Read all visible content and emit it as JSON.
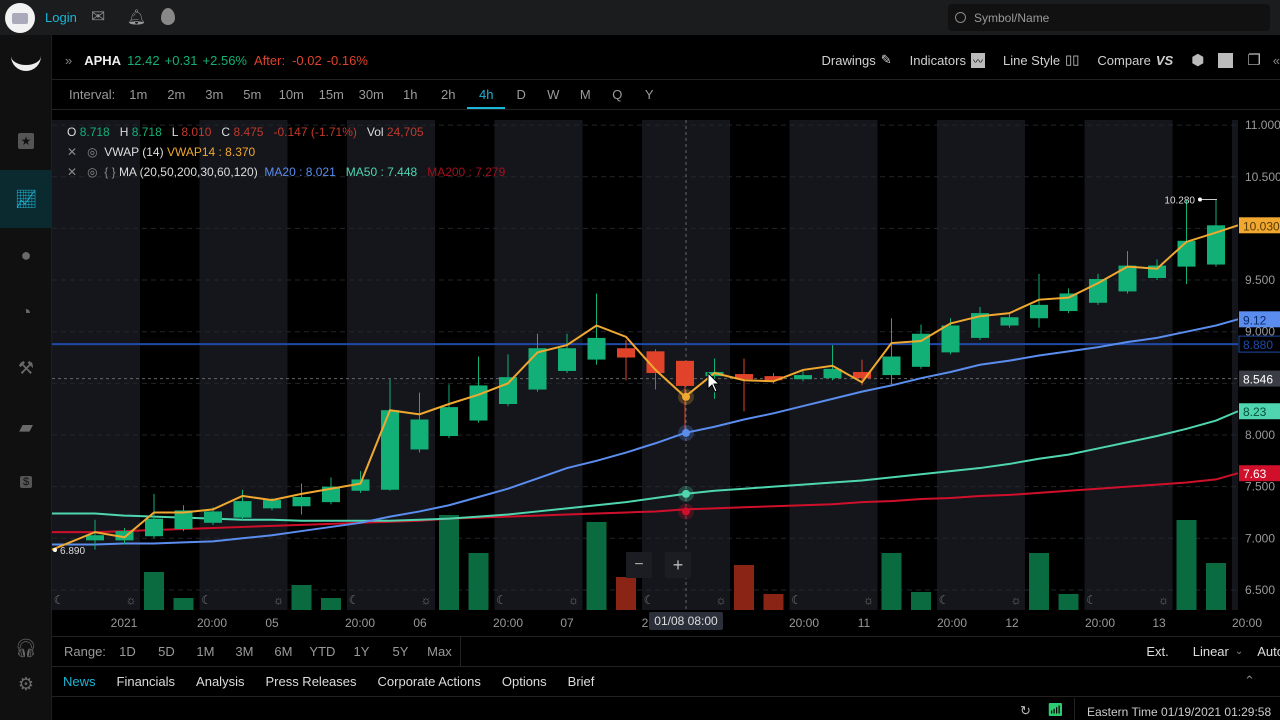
{
  "topbar": {
    "login": "Login",
    "search_placeholder": "Symbol/Name",
    "icons": [
      "avatar",
      "mail-icon",
      "bell-icon",
      "flame-icon"
    ]
  },
  "sidebar": {
    "items": [
      "star-icon",
      "chart-icon",
      "planet-icon",
      "chat-chart-icon",
      "gavel-icon",
      "wallet-icon",
      "dollar-icon"
    ],
    "bottom": [
      "headset-icon",
      "gear-icon"
    ],
    "active": "chart-icon"
  },
  "quote": {
    "symbol": "APHA",
    "price": "12.42",
    "change": "+0.31",
    "change_pct": "+2.56%",
    "after_label": "After:",
    "after_change": "-0.02",
    "after_pct": "-0.16%"
  },
  "toolbar": {
    "drawings": "Drawings",
    "indicators": "Indicators",
    "line_style": "Line Style",
    "compare": "Compare",
    "compare_badge": "VS"
  },
  "interval": {
    "label": "Interval:",
    "options": [
      "1m",
      "2m",
      "3m",
      "5m",
      "10m",
      "15m",
      "30m",
      "1h",
      "2h",
      "4h",
      "D",
      "W",
      "M",
      "Q",
      "Y"
    ],
    "selected": "4h"
  },
  "legend": {
    "ohlc": {
      "o_label": "O",
      "o": "8.718",
      "h_label": "H",
      "h": "8.718",
      "l_label": "L",
      "l": "8.010",
      "c_label": "C",
      "c": "8.475",
      "chg": "-0.147 (-1.71%)",
      "vol_label": "Vol",
      "vol": "24,705"
    },
    "vwap": {
      "name": "VWAP (14)",
      "value": "VWAP14 : 8.370"
    },
    "ma": {
      "braces": "{ }",
      "name": "MA (20,50,200,30,60,120)",
      "ma20": "MA20 : 8.021",
      "ma50": "MA50 : 7.448",
      "ma200": "MA200 : 7.279"
    }
  },
  "colors": {
    "up": "#12b076",
    "down": "#e0432a",
    "vwap": "#f0a830",
    "ma20": "#5b8def",
    "ma50": "#4fd6b0",
    "ma200": "#d0102a",
    "hline": "#1f4aa8",
    "accent": "#1bb5d6"
  },
  "chart_data": {
    "type": "candlestick",
    "ylim": [
      6.4,
      11.05
    ],
    "y_ticks": [
      "11.000",
      "10.500",
      "9.500",
      "9.000",
      "8.000",
      "7.500",
      "7.000",
      "6.500"
    ],
    "x_ticks": [
      "2021",
      "20:00",
      "05",
      "20:00",
      "06",
      "20:00",
      "07",
      "2",
      "20:00",
      "11",
      "20:00",
      "12",
      "20:00",
      "13",
      "20:00"
    ],
    "crosshair": {
      "time": "01/08 08:00",
      "price": "8.546"
    },
    "high_marker": "10.280",
    "low_marker": "6.890",
    "price_labels": {
      "vwap": "10.030",
      "ma20": "9.12",
      "hline": "8.880",
      "ma50": "8.23",
      "ma200": "7.63"
    },
    "candles": [
      [
        6.98,
        7.18,
        6.89,
        7.03
      ],
      [
        6.98,
        7.1,
        6.94,
        7.07
      ],
      [
        7.02,
        7.43,
        7.0,
        7.19
      ],
      [
        7.09,
        7.32,
        7.07,
        7.27
      ],
      [
        7.15,
        7.3,
        7.13,
        7.26
      ],
      [
        7.2,
        7.47,
        7.18,
        7.36
      ],
      [
        7.29,
        7.39,
        7.27,
        7.37
      ],
      [
        7.31,
        7.53,
        7.23,
        7.4
      ],
      [
        7.35,
        7.59,
        7.33,
        7.5
      ],
      [
        7.46,
        7.65,
        7.44,
        7.57
      ],
      [
        7.47,
        8.54,
        7.46,
        8.24
      ],
      [
        7.86,
        8.41,
        7.83,
        8.15
      ],
      [
        7.99,
        8.49,
        7.97,
        8.27
      ],
      [
        8.14,
        8.76,
        8.12,
        8.48
      ],
      [
        8.3,
        8.78,
        8.28,
        8.56
      ],
      [
        8.44,
        8.98,
        8.42,
        8.84
      ],
      [
        8.62,
        8.98,
        8.6,
        8.84
      ],
      [
        8.73,
        9.37,
        8.68,
        8.94
      ],
      [
        8.84,
        8.92,
        8.53,
        8.75
      ],
      [
        8.81,
        8.83,
        8.44,
        8.6
      ],
      [
        8.718,
        8.718,
        8.01,
        8.475
      ],
      [
        8.57,
        8.74,
        8.35,
        8.61
      ],
      [
        8.59,
        8.74,
        8.23,
        8.54
      ],
      [
        8.57,
        8.6,
        8.5,
        8.53
      ],
      [
        8.54,
        8.62,
        8.52,
        8.58
      ],
      [
        8.55,
        8.87,
        8.53,
        8.64
      ],
      [
        8.61,
        8.73,
        8.48,
        8.55
      ],
      [
        8.58,
        9.13,
        8.48,
        8.76
      ],
      [
        8.66,
        9.07,
        8.64,
        8.98
      ],
      [
        8.8,
        9.13,
        8.78,
        9.06
      ],
      [
        8.94,
        9.24,
        8.92,
        9.18
      ],
      [
        9.06,
        9.18,
        9.04,
        9.14
      ],
      [
        9.13,
        9.56,
        9.04,
        9.26
      ],
      [
        9.2,
        9.42,
        9.18,
        9.37
      ],
      [
        9.28,
        9.56,
        9.26,
        9.51
      ],
      [
        9.39,
        9.78,
        9.37,
        9.64
      ],
      [
        9.52,
        9.7,
        9.5,
        9.64
      ],
      [
        9.63,
        10.28,
        9.46,
        9.88
      ],
      [
        9.65,
        10.28,
        9.63,
        10.03
      ]
    ],
    "vwap": [
      7.06,
      7.01,
      7.25,
      7.25,
      7.28,
      7.41,
      7.37,
      7.43,
      7.48,
      7.53,
      8.24,
      8.2,
      8.3,
      8.39,
      8.5,
      8.8,
      8.87,
      9.06,
      8.95,
      8.63,
      8.37,
      8.6,
      8.53,
      8.52,
      8.63,
      8.67,
      8.51,
      8.89,
      8.91,
      9.08,
      9.15,
      9.18,
      9.31,
      9.33,
      9.47,
      9.63,
      9.61,
      9.87,
      9.96
    ],
    "ma20": [
      6.94,
      6.95,
      6.95,
      6.96,
      6.97,
      7.0,
      7.03,
      7.07,
      7.11,
      7.15,
      7.21,
      7.26,
      7.32,
      7.4,
      7.48,
      7.58,
      7.68,
      7.75,
      7.83,
      7.92,
      8.02,
      8.08,
      8.15,
      8.21,
      8.28,
      8.35,
      8.42,
      8.48,
      8.55,
      8.61,
      8.68,
      8.72,
      8.77,
      8.81,
      8.85,
      8.9,
      8.94,
      9.0,
      9.06
    ],
    "ma50": [
      7.24,
      7.22,
      7.21,
      7.2,
      7.19,
      7.18,
      7.18,
      7.17,
      7.17,
      7.17,
      7.17,
      7.18,
      7.19,
      7.21,
      7.23,
      7.26,
      7.29,
      7.32,
      7.35,
      7.39,
      7.43,
      7.46,
      7.48,
      7.5,
      7.52,
      7.54,
      7.56,
      7.59,
      7.62,
      7.65,
      7.68,
      7.72,
      7.77,
      7.81,
      7.87,
      7.93,
      7.99,
      8.06,
      8.14
    ],
    "ma200": [
      7.06,
      7.07,
      7.08,
      7.09,
      7.1,
      7.11,
      7.12,
      7.13,
      7.14,
      7.15,
      7.16,
      7.17,
      7.19,
      7.2,
      7.21,
      7.22,
      7.23,
      7.24,
      7.25,
      7.26,
      7.28,
      7.29,
      7.3,
      7.31,
      7.32,
      7.33,
      7.35,
      7.36,
      7.38,
      7.39,
      7.41,
      7.42,
      7.44,
      7.46,
      7.48,
      7.5,
      7.52,
      7.54,
      7.57
    ],
    "hline": 8.88,
    "volume": [
      null,
      null,
      76000,
      24000,
      null,
      null,
      null,
      50000,
      24000,
      null,
      null,
      null,
      190000,
      114000,
      null,
      null,
      null,
      176000,
      66000,
      null,
      null,
      null,
      90000,
      32000,
      null,
      null,
      null,
      114000,
      36000,
      null,
      null,
      null,
      114000,
      32000,
      null,
      null,
      null,
      180000,
      94000
    ]
  },
  "zoom": {
    "minus": "−",
    "plus": "+"
  },
  "range": {
    "label": "Range:",
    "options": [
      "1D",
      "5D",
      "1M",
      "3M",
      "6M",
      "YTD",
      "1Y",
      "5Y",
      "Max"
    ],
    "ext": "Ext.",
    "scale": "Linear",
    "auto": "Auto"
  },
  "tabs": {
    "items": [
      "News",
      "Financials",
      "Analysis",
      "Press Releases",
      "Corporate Actions",
      "Options",
      "Brief"
    ],
    "active": "News"
  },
  "status": {
    "time": "Eastern Time 01/19/2021 01:29:58"
  }
}
